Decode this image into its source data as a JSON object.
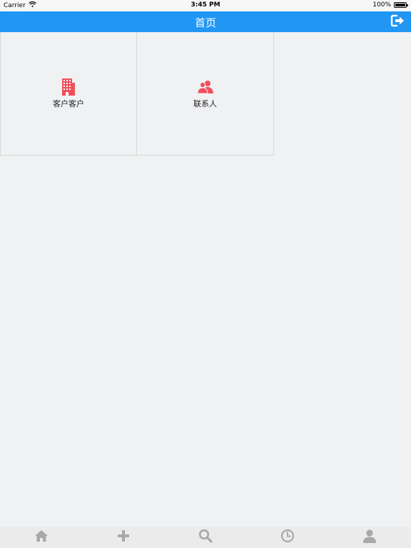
{
  "status_bar": {
    "carrier": "Carrier",
    "time": "3:45 PM",
    "battery": "100%",
    "battery_level": 1.0
  },
  "nav": {
    "title": "首页",
    "logout_icon": "logout-icon"
  },
  "grid": {
    "items": [
      {
        "label": "客户客户",
        "icon": "building-icon"
      },
      {
        "label": "联系人",
        "icon": "contacts-icon"
      }
    ]
  },
  "tab_bar": {
    "tabs": [
      {
        "icon": "home-icon"
      },
      {
        "icon": "add-icon"
      },
      {
        "icon": "search-icon"
      },
      {
        "icon": "clock-icon"
      },
      {
        "icon": "user-icon"
      }
    ]
  },
  "colors": {
    "nav_bg": "#2196f3",
    "accent_icon": "#f0505a",
    "tab_icon": "#a8a8a8",
    "background": "#f0f1f3"
  }
}
